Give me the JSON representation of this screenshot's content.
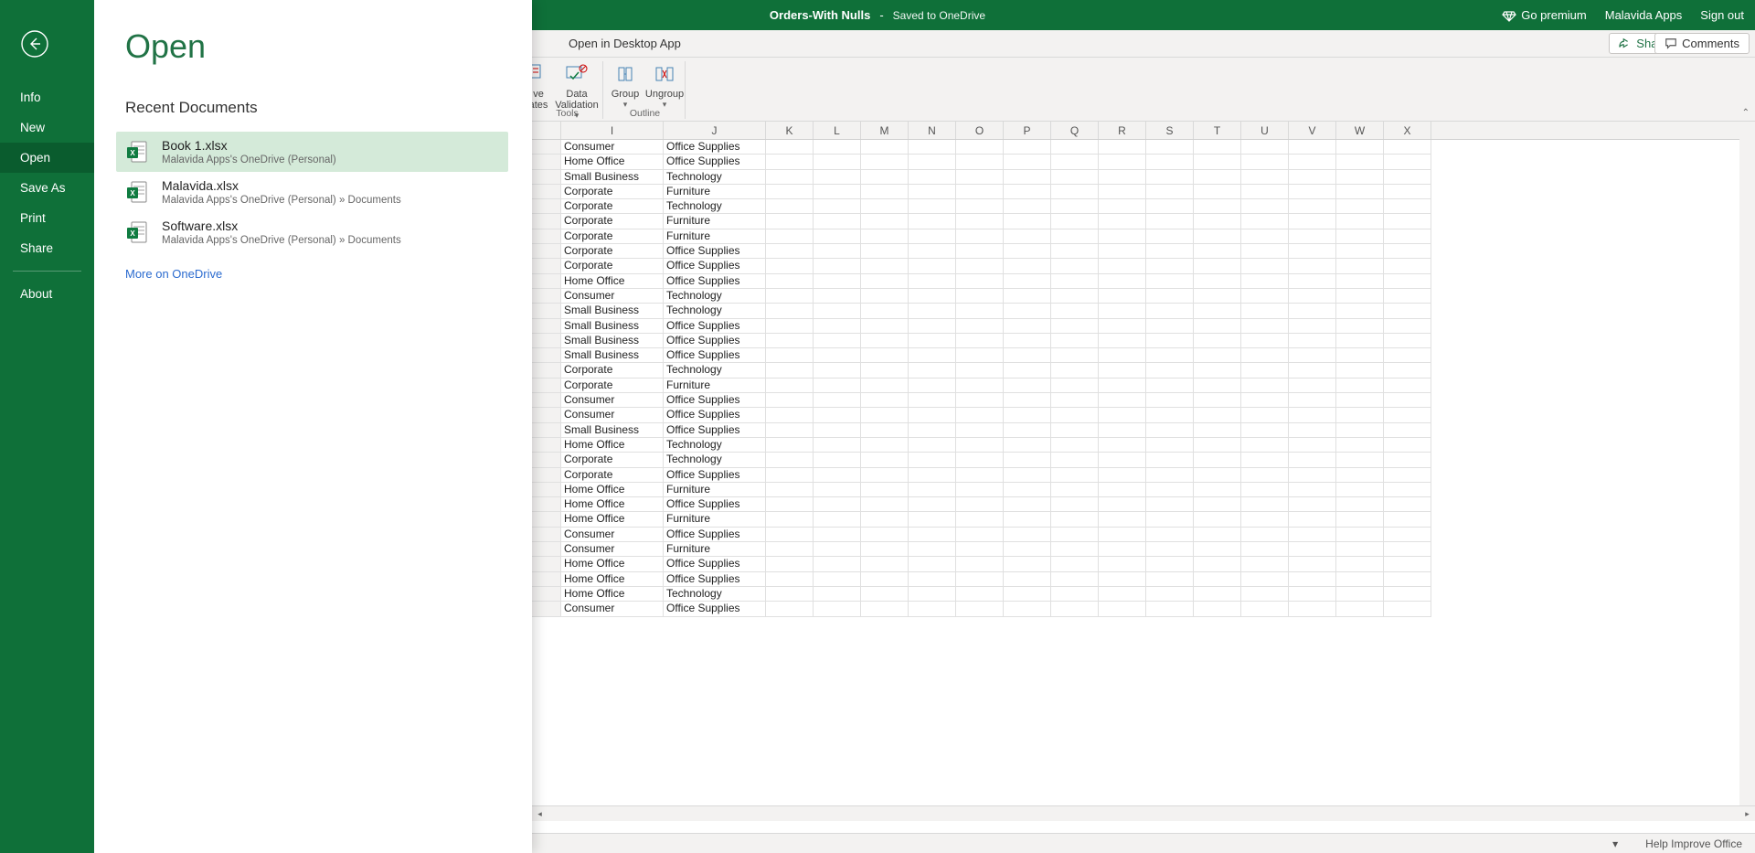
{
  "titlebar": {
    "doc": "Orders-With Nulls",
    "dash": "-",
    "saved": "Saved to OneDrive",
    "premium": "Go premium",
    "user": "Malavida Apps",
    "signout": "Sign out"
  },
  "toolbar": {
    "opendesk": "Open in Desktop App",
    "share": "Share",
    "comments": "Comments"
  },
  "ribbon": {
    "dv_frag_top": "ve",
    "dv_frag_bot": "ates",
    "data_top": "Data",
    "data_bot": "Validation",
    "group": "Group",
    "ungroup": "Ungroup",
    "tools_lbl": "Tools",
    "outline_lbl": "Outline"
  },
  "sheet": {
    "cols": [
      "",
      "I",
      "J",
      "K",
      "L",
      "M",
      "N",
      "O",
      "P",
      "Q",
      "R",
      "S",
      "T",
      "U",
      "V",
      "W",
      "X"
    ],
    "rows": [
      {
        "i": "Consumer",
        "j": "Office Supplies"
      },
      {
        "i": "Home Office",
        "j": "Office Supplies"
      },
      {
        "i": "Small Business",
        "j": "Technology"
      },
      {
        "i": "Corporate",
        "j": "Furniture"
      },
      {
        "i": "Corporate",
        "j": "Technology"
      },
      {
        "i": "Corporate",
        "j": "Furniture"
      },
      {
        "i": "Corporate",
        "j": "Furniture"
      },
      {
        "i": "Corporate",
        "j": "Office Supplies"
      },
      {
        "i": "Corporate",
        "j": "Office Supplies"
      },
      {
        "i": "Home Office",
        "j": "Office Supplies"
      },
      {
        "i": "Consumer",
        "j": "Technology"
      },
      {
        "i": "Small Business",
        "j": "Technology"
      },
      {
        "i": "Small Business",
        "j": "Office Supplies"
      },
      {
        "i": "Small Business",
        "j": "Office Supplies"
      },
      {
        "i": "Small Business",
        "j": "Office Supplies"
      },
      {
        "i": "Corporate",
        "j": "Technology"
      },
      {
        "i": "Corporate",
        "j": "Furniture"
      },
      {
        "i": "Consumer",
        "j": "Office Supplies"
      },
      {
        "i": "Consumer",
        "j": "Office Supplies"
      },
      {
        "i": "Small Business",
        "j": "Office Supplies"
      },
      {
        "i": "Home Office",
        "j": "Technology"
      },
      {
        "i": "Corporate",
        "j": "Technology"
      },
      {
        "i": "Corporate",
        "j": "Office Supplies"
      },
      {
        "i": "Home Office",
        "j": "Furniture"
      },
      {
        "i": "Home Office",
        "j": "Office Supplies"
      },
      {
        "i": "Home Office",
        "j": "Furniture"
      },
      {
        "i": "Consumer",
        "j": "Office Supplies"
      },
      {
        "i": "Consumer",
        "j": "Furniture"
      },
      {
        "i": "Home Office",
        "j": "Office Supplies"
      },
      {
        "i": "Home Office",
        "j": "Office Supplies"
      },
      {
        "i": "Home Office",
        "j": "Technology"
      },
      {
        "i": "Consumer",
        "j": "Office Supplies"
      }
    ]
  },
  "footer": {
    "help": "Help Improve Office"
  },
  "backstage": {
    "title": "Open",
    "nav": {
      "info": "Info",
      "new": "New",
      "open": "Open",
      "saveas": "Save As",
      "print": "Print",
      "share": "Share",
      "about": "About"
    },
    "sub": "Recent Documents",
    "docs": [
      {
        "name": "Book 1.xlsx",
        "path": "Malavida Apps's OneDrive (Personal)"
      },
      {
        "name": "Malavida.xlsx",
        "path": "Malavida Apps's OneDrive (Personal) » Documents"
      },
      {
        "name": "Software.xlsx",
        "path": "Malavida Apps's OneDrive (Personal) » Documents"
      }
    ],
    "more": "More on OneDrive"
  }
}
